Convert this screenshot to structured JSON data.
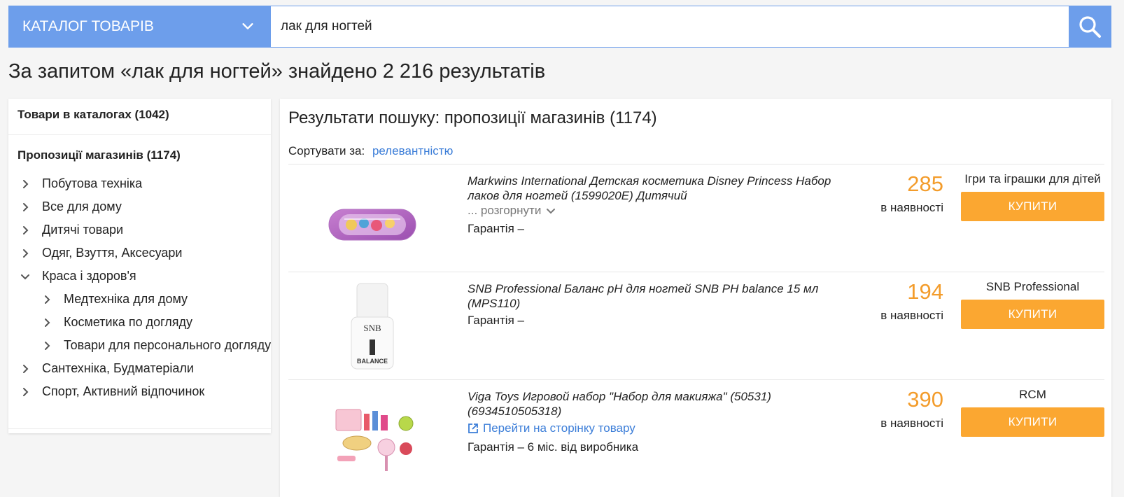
{
  "search": {
    "catalog_label": "КАТАЛОГ ТОВАРІВ",
    "query": "лак для ногтей",
    "search_icon": "search-icon"
  },
  "headline": "За запитом «лак для ногтей» знайдено 2 216 результатів",
  "sidebar": {
    "goods_label": "Товари в каталогах (1042)",
    "offers_label": "Пропозиції магазинів (1174)",
    "categories": [
      {
        "label": "Побутова техніка",
        "expanded": false,
        "level": 0
      },
      {
        "label": "Все для дому",
        "expanded": false,
        "level": 0
      },
      {
        "label": "Дитячі товари",
        "expanded": false,
        "level": 0
      },
      {
        "label": "Одяг, Взуття, Аксесуари",
        "expanded": false,
        "level": 0
      },
      {
        "label": "Краса і здоров'я",
        "expanded": true,
        "level": 0
      },
      {
        "label": "Медтехніка для дому",
        "expanded": false,
        "level": 1
      },
      {
        "label": "Косметика по догляду",
        "expanded": false,
        "level": 1
      },
      {
        "label": "Товари для персонального догляду",
        "expanded": false,
        "level": 1
      },
      {
        "label": "Сантехніка, Будматеріали",
        "expanded": false,
        "level": 0
      },
      {
        "label": "Спорт, Активний відпочинок",
        "expanded": false,
        "level": 0
      }
    ]
  },
  "results": {
    "title": "Результати пошуку: пропозиції магазинів (1174)",
    "sort_label": "Сортувати за:",
    "sort_value": "релевантністю",
    "items": [
      {
        "name": "Markwins International Детская косметика Disney Princess Набор лаков для ногтей (1599020E) Дитячий",
        "expand_label": "... розгорнути",
        "warranty": "Гарантія –",
        "price": "285",
        "availability": "в наявності",
        "shop": "Ігри та іграшки для дітей",
        "buy_label": "КУПИТИ"
      },
      {
        "name": "SNB Professional Баланс pH для ногтей SNB PH balance 15 мл (MPS110)",
        "warranty": "Гарантія –",
        "price": "194",
        "availability": "в наявності",
        "shop": "SNB Professional",
        "buy_label": "КУПИТИ",
        "thumb_text": "SNB",
        "thumb_label": "BALANCE"
      },
      {
        "name": "Viga Toys Игровой набор \"Набор для макияжа\" (50531) (6934510505318)",
        "link_label": "Перейти на сторінку товару",
        "warranty": "Гарантія – 6 міс. від виробника",
        "price": "390",
        "availability": "в наявності",
        "shop": "RCM",
        "buy_label": "КУПИТИ"
      }
    ]
  },
  "colors": {
    "accent": "#6d9eeb",
    "price": "#f39c2b",
    "buy_button": "#fba731",
    "link": "#3b7dd8"
  }
}
